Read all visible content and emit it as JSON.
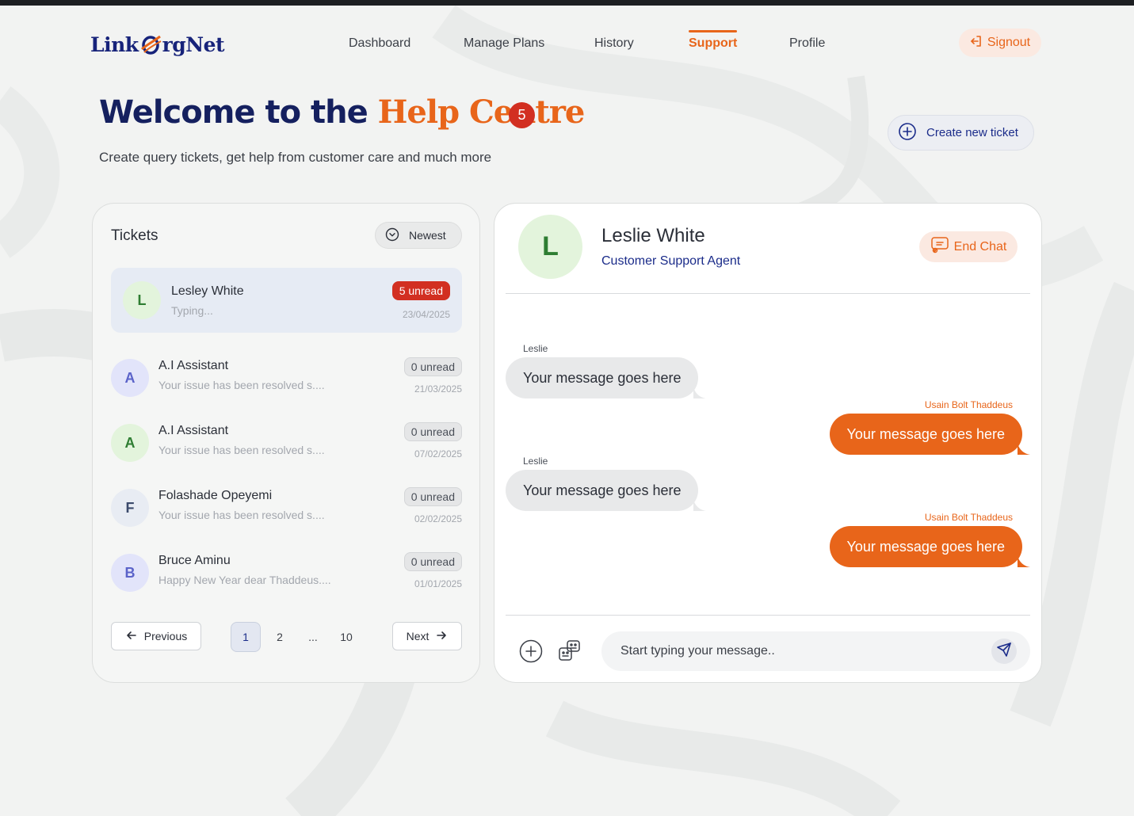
{
  "app": {
    "brand": "LinkOrgNet",
    "brand_parts": [
      "Link",
      "rgNet"
    ]
  },
  "nav": {
    "items": [
      {
        "label": "Dashboard",
        "active": false
      },
      {
        "label": "Manage Plans",
        "active": false
      },
      {
        "label": "History",
        "active": false
      },
      {
        "label": "Support",
        "active": true
      },
      {
        "label": "Profile",
        "active": false
      }
    ],
    "signout_label": "Signout"
  },
  "hero": {
    "title_part1": "Welcome to the ",
    "title_part2": "Help Centre",
    "badge_count": "5",
    "subtitle": "Create query tickets, get help from customer care and much more",
    "create_ticket_label": "Create new ticket"
  },
  "tickets": {
    "title": "Tickets",
    "sort_label": "Newest",
    "items": [
      {
        "initial": "L",
        "name": "Lesley White",
        "preview": "Typing...",
        "unread": "5 unread",
        "date": "23/04/2025",
        "avatar_bg": "#e3f4dc",
        "avatar_fg": "#2e7d32"
      },
      {
        "initial": "A",
        "name": "A.I Assistant",
        "preview": "Your issue has been resolved s....",
        "unread": "0 unread",
        "date": "21/03/2025",
        "avatar_bg": "#e2e4fa",
        "avatar_fg": "#5b63c9"
      },
      {
        "initial": "A",
        "name": "A.I Assistant",
        "preview": "Your issue has been resolved s....",
        "unread": "0 unread",
        "date": "07/02/2025",
        "avatar_bg": "#e3f4dc",
        "avatar_fg": "#2e7d32"
      },
      {
        "initial": "F",
        "name": "Folashade Opeyemi",
        "preview": "Your issue has been resolved s....",
        "unread": "0 unread",
        "date": "02/02/2025",
        "avatar_bg": "#e8ecf3",
        "avatar_fg": "#3b4a6b"
      },
      {
        "initial": "B",
        "name": "Bruce Aminu",
        "preview": "Happy New Year dear Thaddeus....",
        "unread": "0 unread",
        "date": "01/01/2025",
        "avatar_bg": "#e2e4fa",
        "avatar_fg": "#5b63c9"
      }
    ],
    "pagination": {
      "previous_label": "Previous",
      "next_label": "Next",
      "pages": [
        "1",
        "2",
        "...",
        "10"
      ],
      "current": "1"
    }
  },
  "chat": {
    "agent_initial": "L",
    "agent_name": "Leslie White",
    "agent_role": "Customer Support Agent",
    "end_chat_label": "End Chat",
    "messages": [
      {
        "sender": "Leslie",
        "text": "Your message goes here",
        "direction": "in"
      },
      {
        "sender": "Usain Bolt Thaddeus",
        "text": "Your message goes here",
        "direction": "out"
      },
      {
        "sender": "Leslie",
        "text": "Your message goes here",
        "direction": "in"
      },
      {
        "sender": "Usain Bolt Thaddeus",
        "text": "Your message goes here",
        "direction": "out"
      }
    ],
    "input_placeholder": "Start typing your message.."
  },
  "colors": {
    "accent": "#e8651a",
    "brand_navy": "#15205f",
    "alert_red": "#d22f21",
    "link_blue": "#1b2c8a"
  },
  "icons": {
    "signout": "signout-icon",
    "create": "plus-circle-icon",
    "sort": "chevron-down-circle-icon",
    "end_chat": "chat-end-icon",
    "attach": "plus-circle-icon",
    "emoji": "sticker-icon",
    "send": "send-icon",
    "prev": "arrow-left-icon",
    "next": "arrow-right-icon"
  }
}
